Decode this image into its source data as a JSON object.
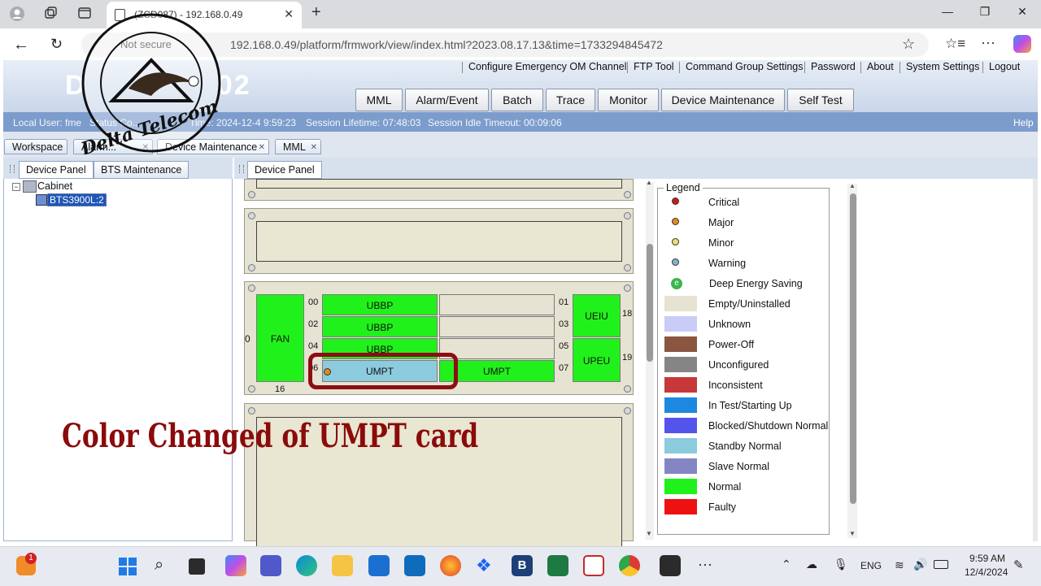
{
  "browser": {
    "tab_title": "(ZCD087) - 192.168.0.49",
    "not_secure": "Not secure",
    "url": "192.168.0.49/platform/frmwork/view/index.html?2023.08.17.13&time=1733294845472"
  },
  "top_links": [
    "Configure Emergency OM Channel",
    "FTP Tool",
    "Command Group Settings",
    "Password",
    "About",
    "System Settings",
    "Logout"
  ],
  "menu": [
    "MML",
    "Alarm/Event",
    "Batch",
    "Trace",
    "Monitor",
    "Device Maintenance",
    "Self Test"
  ],
  "status": {
    "user": "Local User: fme",
    "status_prefix": "Status Co...",
    "time": "Time: 2024-12-4 9:59:23",
    "lifetime": "Session Lifetime: 07:48:03",
    "idle": "Session Idle Timeout: 00:09:06",
    "help": "Help"
  },
  "app_tabs": [
    "Workspace",
    "Alarm...",
    "Device Maintenance",
    "MML"
  ],
  "left_tabs": [
    "Device Panel",
    "BTS Maintenance"
  ],
  "right_tab": "Device Panel",
  "tree": {
    "root": "Cabinet",
    "child": "BTS3900L:2"
  },
  "subrack": {
    "row_label": "0",
    "fan_label": "FAN",
    "fan_slot": "16",
    "slots": [
      {
        "num": "00",
        "label": "UBBP",
        "status": "normal"
      },
      {
        "num": "02",
        "label": "UBBP",
        "status": "normal"
      },
      {
        "num": "04",
        "label": "UBBP",
        "status": "normal"
      },
      {
        "num": "06",
        "label": "UMPT",
        "status": "standby",
        "alarm": "major"
      },
      {
        "num": "01",
        "label": "",
        "status": "empty"
      },
      {
        "num": "03",
        "label": "",
        "status": "empty"
      },
      {
        "num": "05",
        "label": "",
        "status": "empty"
      },
      {
        "num": "07",
        "label": "UMPT",
        "status": "normal"
      }
    ],
    "right_modules": [
      {
        "label": "UEIU",
        "num": "18"
      },
      {
        "label": "UPEU",
        "num": "19"
      }
    ]
  },
  "legend": {
    "title": "Legend",
    "alarms": [
      {
        "label": "Critical",
        "color": "#cc1b1b"
      },
      {
        "label": "Major",
        "color": "#e08a20"
      },
      {
        "label": "Minor",
        "color": "#eedd77"
      },
      {
        "label": "Warning",
        "color": "#7fb7c9"
      },
      {
        "label": "Deep Energy Saving",
        "color": "#3ab54a"
      }
    ],
    "states": [
      {
        "label": "Empty/Uninstalled",
        "color": "#e6e3d2"
      },
      {
        "label": "Unknown",
        "color": "#c8ccf6"
      },
      {
        "label": "Power-Off",
        "color": "#8b5640"
      },
      {
        "label": "Unconfigured",
        "color": "#858585"
      },
      {
        "label": "Inconsistent",
        "color": "#c8383a"
      },
      {
        "label": "In Test/Starting Up",
        "color": "#1c88e0"
      },
      {
        "label": "Blocked/Shutdown Normal",
        "color": "#5454ec"
      },
      {
        "label": "Standby Normal",
        "color": "#8ccbdd"
      },
      {
        "label": "Slave Normal",
        "color": "#8585c4"
      },
      {
        "label": "Normal",
        "color": "#21f11b"
      },
      {
        "label": "Faulty",
        "color": "#ee1111"
      }
    ]
  },
  "annotation": "Color Changed  of UMPT card",
  "watermark": "MY YOUTUBE CHANNEL Delta Telecom",
  "taskbar": {
    "lang": "ENG",
    "time": "9:59 AM",
    "date": "12/4/2024",
    "badge": "1"
  }
}
